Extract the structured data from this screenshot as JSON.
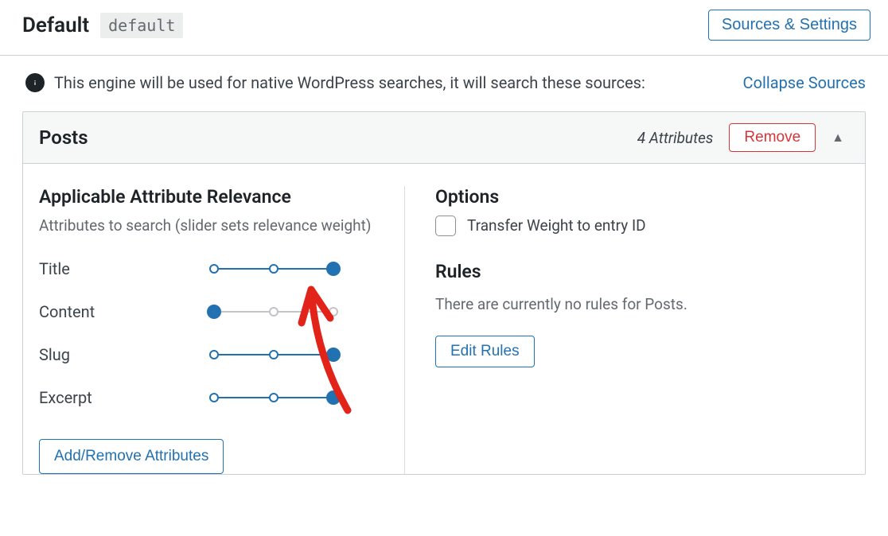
{
  "header": {
    "title": "Default",
    "tag": "default",
    "sources_settings_label": "Sources & Settings"
  },
  "info": {
    "text": "This engine will be used for native WordPress searches, it will search these sources:",
    "collapse_label": "Collapse Sources"
  },
  "panel": {
    "title": "Posts",
    "attr_count": "4 Attributes",
    "remove_label": "Remove"
  },
  "left": {
    "title": "Applicable Attribute Relevance",
    "subtitle": "Attributes to search (slider sets relevance weight)",
    "attributes": [
      {
        "label": "Title",
        "value": 2,
        "fill_from": 0,
        "fill_to": 2
      },
      {
        "label": "Content",
        "value": 0,
        "fill_from": 0,
        "fill_to": 0
      },
      {
        "label": "Slug",
        "value": 2,
        "fill_from": 0,
        "fill_to": 2
      },
      {
        "label": "Excerpt",
        "value": 2,
        "fill_from": 0,
        "fill_to": 2
      }
    ],
    "add_remove_label": "Add/Remove Attributes"
  },
  "right": {
    "options_title": "Options",
    "transfer_label": "Transfer Weight to entry ID",
    "rules_title": "Rules",
    "rules_text": "There are currently no rules for Posts.",
    "edit_rules_label": "Edit Rules"
  }
}
